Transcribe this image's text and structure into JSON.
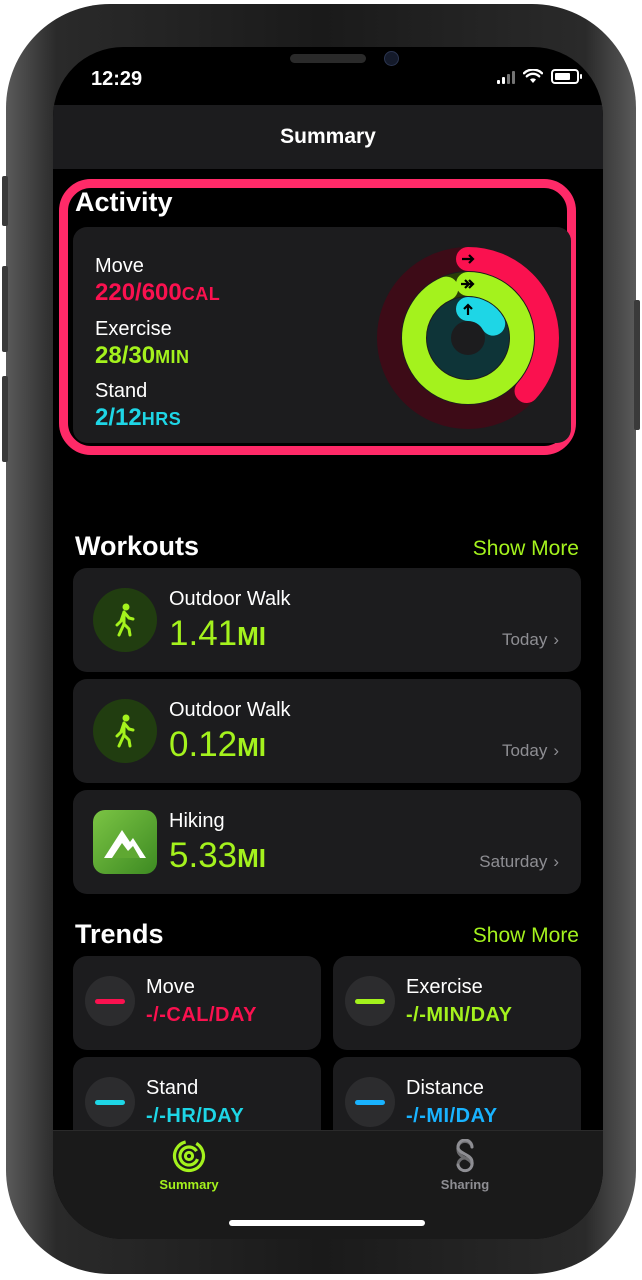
{
  "status_bar": {
    "time": "12:29"
  },
  "nav": {
    "title": "Summary"
  },
  "activity": {
    "title": "Activity",
    "move": {
      "label": "Move",
      "value": "220/600",
      "unit": "CAL",
      "progress": 0.367,
      "color": "#fa114f"
    },
    "exercise": {
      "label": "Exercise",
      "value": "28/30",
      "unit": "MIN",
      "progress": 0.933,
      "color": "#a4f21d"
    },
    "stand": {
      "label": "Stand",
      "value": "2/12",
      "unit": "HRS",
      "progress": 0.167,
      "color": "#1ed6e6"
    }
  },
  "workouts": {
    "title": "Workouts",
    "show_more": "Show More",
    "items": [
      {
        "name": "Outdoor Walk",
        "value": "1.41",
        "unit": "MI",
        "date": "Today",
        "icon": "walking-figure-icon"
      },
      {
        "name": "Outdoor Walk",
        "value": "0.12",
        "unit": "MI",
        "date": "Today",
        "icon": "walking-figure-icon"
      },
      {
        "name": "Hiking",
        "value": "5.33",
        "unit": "MI",
        "date": "Saturday",
        "icon": "mountain-app-icon"
      }
    ]
  },
  "trends": {
    "title": "Trends",
    "show_more": "Show More",
    "items": [
      {
        "name": "Move",
        "value": "-/-",
        "unit": "CAL/DAY",
        "color": "#fa114f"
      },
      {
        "name": "Exercise",
        "value": "-/-",
        "unit": "MIN/DAY",
        "color": "#a4f21d"
      },
      {
        "name": "Stand",
        "value": "-/-",
        "unit": "HR/DAY",
        "color": "#1ed6e6"
      },
      {
        "name": "Distance",
        "value": "-/-",
        "unit": "MI/DAY",
        "color": "#19b3ff"
      }
    ]
  },
  "tabbar": {
    "summary": {
      "label": "Summary",
      "color": "#a4f21d"
    },
    "sharing": {
      "label": "Sharing",
      "color": "#8e8e93"
    }
  }
}
